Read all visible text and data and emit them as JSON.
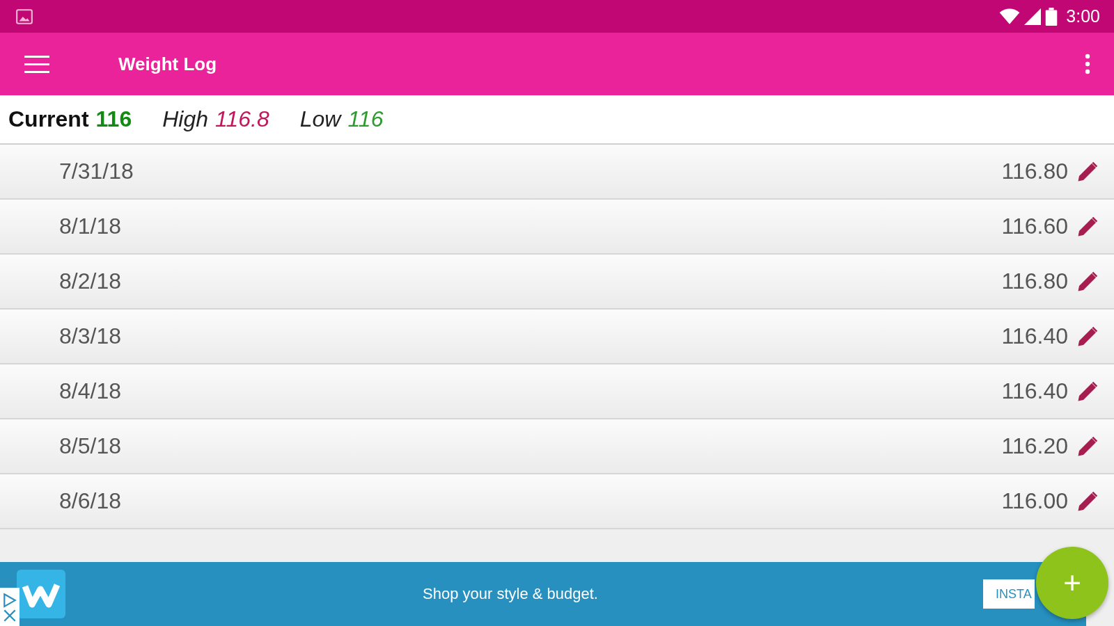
{
  "status_bar": {
    "time": "3:00"
  },
  "app_bar": {
    "title": "Weight Log"
  },
  "summary": [
    {
      "kind": "current",
      "label": "Current",
      "value": "116",
      "color": "#138a13"
    },
    {
      "kind": "extreme",
      "label": "High",
      "value": "116.8",
      "color": "#c2185b"
    },
    {
      "kind": "extreme",
      "label": "Low",
      "value": "116",
      "color": "#2e9b2e"
    }
  ],
  "entries": [
    {
      "date": "7/31/18",
      "weight": "116.80"
    },
    {
      "date": "8/1/18",
      "weight": "116.60"
    },
    {
      "date": "8/2/18",
      "weight": "116.80"
    },
    {
      "date": "8/3/18",
      "weight": "116.40"
    },
    {
      "date": "8/4/18",
      "weight": "116.40"
    },
    {
      "date": "8/5/18",
      "weight": "116.20"
    },
    {
      "date": "8/6/18",
      "weight": "116.00"
    }
  ],
  "ad": {
    "text": "Shop your style & budget.",
    "button": "INSTA"
  },
  "fab": {
    "label": "+"
  }
}
